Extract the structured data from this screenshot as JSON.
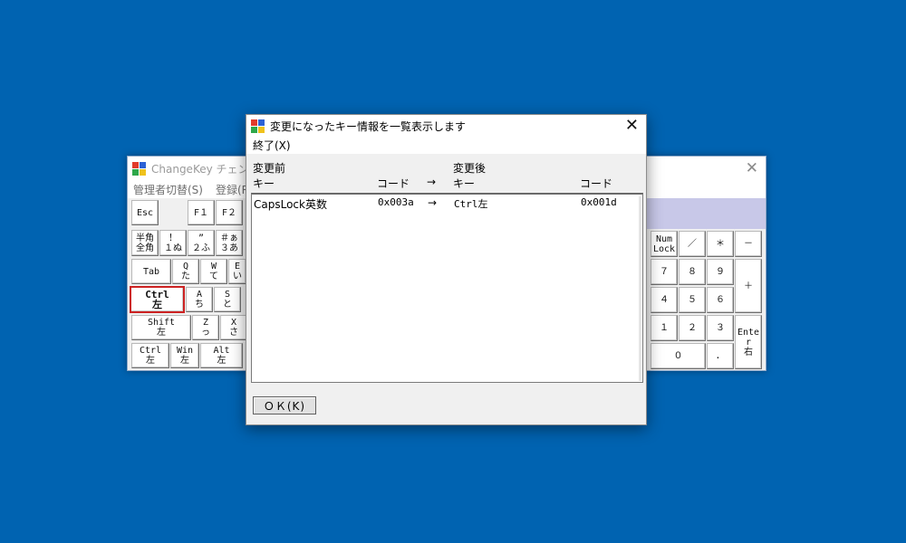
{
  "background_window": {
    "title": "ChangeKey チェンジキ",
    "menu": [
      "管理者切替(S)",
      "登録(R"
    ],
    "keys": {
      "esc": "Esc",
      "f1": "F１",
      "f2": "F２",
      "hankaku_top": "半角",
      "hankaku_bottom": "全角",
      "k1_top": "！",
      "k1_bottom": "１ぬ",
      "k2_top": "”",
      "k2_bottom": "２ふ",
      "k3_top": "＃ぁ",
      "k3_bottom": "３あ",
      "tab": "Tab",
      "q_top": "Q",
      "q_bottom": "た",
      "w_top": "W",
      "w_bottom": "て",
      "e_top": "E",
      "e_bottom": "い",
      "ctrl_left_top": "Ctrl",
      "ctrl_left_bottom": "左",
      "a_top": "A",
      "a_bottom": "ち",
      "s_top": "S",
      "s_bottom": "と",
      "shift_top": "Shift",
      "shift_bottom": "左",
      "z_top": "Z",
      "z_bottom": "っ",
      "x_top": "X",
      "x_bottom": "さ",
      "ctrl2_top": "Ctrl",
      "ctrl2_bottom": "左",
      "win_top": "Win",
      "win_bottom": "左",
      "alt_top": "Alt",
      "alt_bottom": "左",
      "numlock_top": "Num",
      "numlock_bottom": "Lock",
      "slash": "／",
      "star": "＊",
      "minus": "－",
      "n7": "７",
      "n8": "８",
      "n9": "９",
      "plus": "＋",
      "n4": "４",
      "n5": "５",
      "n6": "６",
      "n1": "１",
      "n2": "２",
      "n3": "３",
      "enter_top": "Ente",
      "enter_mid": "r",
      "enter_bottom": "右",
      "n0": "０",
      "dot": "．"
    }
  },
  "dialog": {
    "title": "変更になったキー情報を一覧表示します",
    "menu_exit": "終了(X)",
    "headers": {
      "before": "変更前",
      "after": "変更後",
      "key1": "キー",
      "code1": "コード",
      "arrow": "→",
      "key2": "キー",
      "code2": "コード"
    },
    "rows": [
      {
        "from_key": "CapsLock英数",
        "from_code": "0x003a",
        "arrow": "→",
        "to_key": "Ctrl左",
        "to_code": "0x001d"
      }
    ],
    "ok_label": "ＯＫ(K)"
  }
}
